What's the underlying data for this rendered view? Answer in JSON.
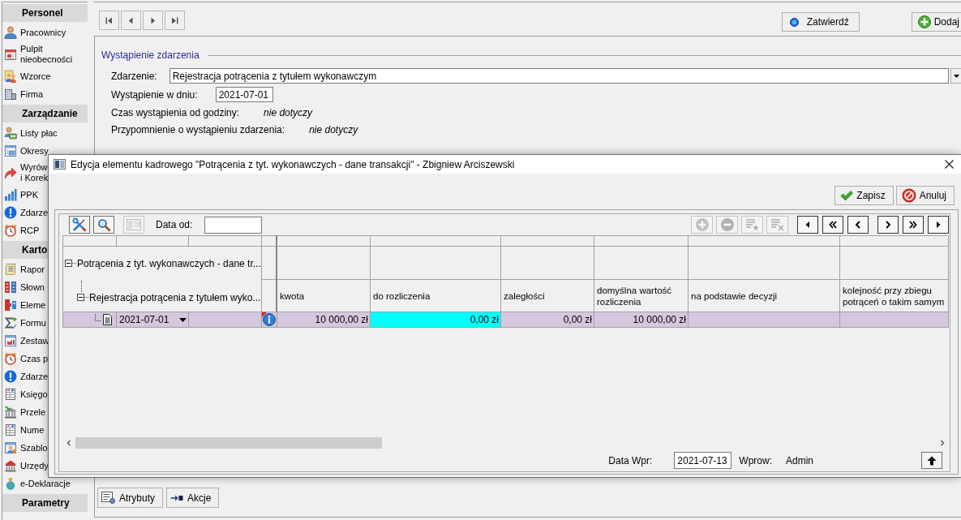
{
  "sidebar": {
    "sections": [
      {
        "title": "Personel",
        "items": [
          {
            "label": "Pracownicy"
          },
          {
            "label": "Pulpit nieobecności"
          },
          {
            "label": "Wzorce"
          },
          {
            "label": "Firma"
          }
        ]
      },
      {
        "title": "Zarządzanie",
        "items": [
          {
            "label": "Listy płac"
          },
          {
            "label": "Okresy"
          },
          {
            "label": "Wyrów\ni Korek"
          },
          {
            "label": "PPK"
          },
          {
            "label": "Zdarze"
          },
          {
            "label": "RCP"
          }
        ]
      },
      {
        "title": "Karto",
        "items": [
          {
            "label": "Rapor"
          },
          {
            "label": "Słown"
          },
          {
            "label": "Eleme"
          },
          {
            "label": "Formu"
          },
          {
            "label": "Zestaw"
          },
          {
            "label": "Czas p"
          },
          {
            "label": "Zdarze"
          },
          {
            "label": "Księgo"
          },
          {
            "label": "Przele"
          },
          {
            "label": "Nume"
          },
          {
            "label": "Szablo"
          },
          {
            "label": "Urzędy"
          },
          {
            "label": "e-Deklaracje"
          }
        ]
      },
      {
        "title": "Parametry"
      }
    ]
  },
  "toolbar": {
    "buttons": [
      {
        "label": "Zatwierdź"
      },
      {
        "label": "Dodaj"
      }
    ]
  },
  "event": {
    "title": "Wystąpienie zdarzenia",
    "fields": [
      {
        "kind": "combo",
        "label": "Zdarzenie:",
        "value": "Rejestracja potrącenia z tytułem wykonawczym"
      },
      {
        "kind": "date",
        "label": "Wystąpienie w dniu:",
        "value": "2021-07-01"
      },
      {
        "kind": "text",
        "label": "Czas wystąpienia od godziny:",
        "value": "nie dotyczy"
      },
      {
        "kind": "text",
        "label": "Przypomnienie o wystąpieniu zdarzenia:",
        "value": "nie dotyczy"
      }
    ]
  },
  "actions": [
    {
      "label": "Atrybuty"
    },
    {
      "label": "Akcje"
    }
  ],
  "dialog": {
    "title": "Edycja elementu kadrowego \"Potrącenia z tyt. wykonawczych - dane transakcji\" - Zbigniew Arciszewski",
    "buttons": [
      {
        "label": "Zapisz"
      },
      {
        "label": "Anuluj"
      }
    ],
    "tools": [
      {
        "disabled": false
      },
      {
        "disabled": false
      },
      {
        "disabled": true
      }
    ],
    "filter": {
      "label": "Data od:"
    },
    "row_tools": [
      {
        "disabled": true
      },
      {
        "disabled": true
      },
      {
        "disabled": true
      },
      {
        "disabled": true
      }
    ],
    "grid": {
      "tree": [
        {
          "label": "Potrącenia z tyt. wykonawczych - dane tr...",
          "expanded": true,
          "children": [
            {
              "label": "Rejestracja potrącenia z tytułem wyko...",
              "expanded": true
            }
          ]
        }
      ],
      "columns": [
        {
          "label": "kwota"
        },
        {
          "label": "do rozliczenia"
        },
        {
          "label": "zaległości"
        },
        {
          "label": "domyślna wartość rozliczenia"
        },
        {
          "label": "na podstawie decyzji"
        },
        {
          "label": "kolejność przy zbiegu potrąceń o takim samym"
        }
      ],
      "rows": [
        {
          "date": "2021-07-01",
          "selected": true,
          "cells": [
            {
              "value": "10 000,00 zł",
              "focused": false
            },
            {
              "value": "0,00 zł",
              "focused": true
            },
            {
              "value": "0,00 zł",
              "focused": false
            },
            {
              "value": "10 000,00 zł",
              "focused": false
            },
            {
              "focused": false
            },
            {
              "focused": false
            }
          ]
        }
      ]
    },
    "status": {
      "date_label": "Data Wpr:",
      "date": "2021-07-13",
      "user_label": "Wprow:",
      "user": "Admin"
    }
  }
}
